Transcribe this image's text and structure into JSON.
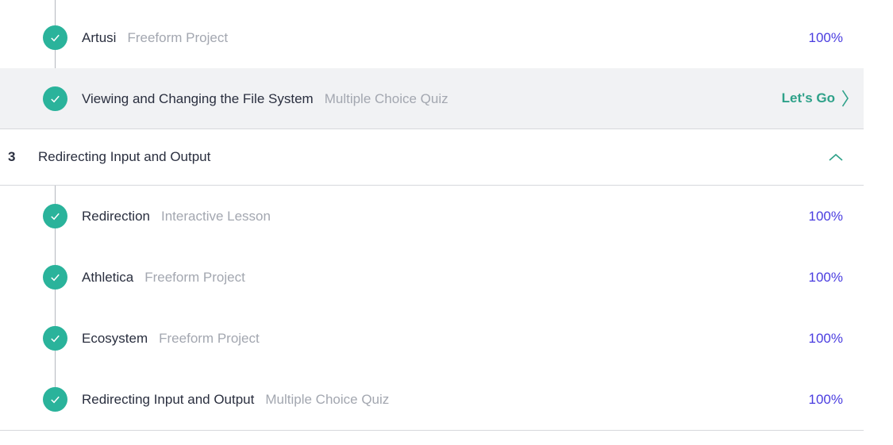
{
  "top_items": [
    {
      "title": "Artusi",
      "type": "Freeform Project",
      "progress": "100%"
    },
    {
      "title": "Viewing and Changing the File System",
      "type": "Multiple Choice Quiz",
      "action": "Let's Go"
    }
  ],
  "section": {
    "number": "3",
    "title": "Redirecting Input and Output"
  },
  "items": [
    {
      "title": "Redirection",
      "type": "Interactive Lesson",
      "progress": "100%"
    },
    {
      "title": "Athletica",
      "type": "Freeform Project",
      "progress": "100%"
    },
    {
      "title": "Ecosystem",
      "type": "Freeform Project",
      "progress": "100%"
    },
    {
      "title": "Redirecting Input and Output",
      "type": "Multiple Choice Quiz",
      "progress": "100%"
    }
  ],
  "colors": {
    "check": "#2ab39b",
    "progress": "#4a3de0",
    "action": "#2ea189",
    "highlight": "#f1f2f4"
  },
  "icons": {
    "status": "checkmark-icon",
    "action": "chevron-right-icon",
    "section_toggle": "chevron-up-icon"
  }
}
